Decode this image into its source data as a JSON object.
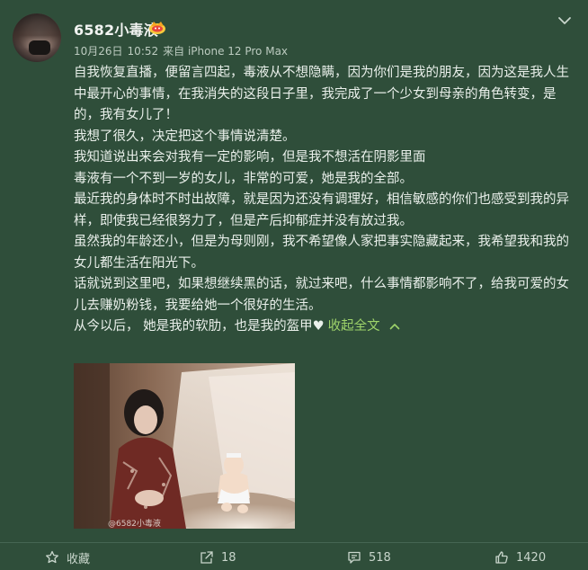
{
  "user": {
    "name": "6582小毒液",
    "vip_icon": "weibo-vip-badge-icon"
  },
  "meta": {
    "date": "10月26日",
    "time": "10:52",
    "source": "来自 iPhone 12 Pro Max"
  },
  "post": {
    "paragraphs": [
      "自我恢复直播，便留言四起，毒液从不想隐瞒，因为你们是我的朋友，因为这是我人生中最开心的事情，在我消失的这段日子里，我完成了一个少女到母亲的角色转变，是的，我有女儿了！",
      "我想了很久，决定把这个事情说清楚。",
      "我知道说出来会对我有一定的影响，但是我不想活在阴影里面",
      "毒液有一个不到一岁的女儿，非常的可爱，她是我的全部。",
      "最近我的身体时不时出故障，就是因为还没有调理好，相信敏感的你们也感受到我的异样，即使我已经很努力了，但是产后抑郁症并没有放过我。",
      "虽然我的年龄还小，但是为母则刚，我不希望像人家把事实隐藏起来，我希望我和我的女儿都生活在阳光下。",
      "话就说到这里吧，如果想继续黑的话，就过来吧，什么事情都影响不了，给我可爱的女儿去赚奶粉钱，我要给她一个很好的生活。"
    ],
    "last_line": "从今以后， 她是我的软肋，也是我的盔甲♥",
    "collapse_label": "收起全文"
  },
  "photo": {
    "watermark": "@6582小毒液"
  },
  "actions": {
    "favorite_label": "收藏",
    "share_count": "18",
    "comment_count": "518",
    "like_count": "1420"
  },
  "colors": {
    "background": "#2f4e3a",
    "link": "#9ed36a",
    "text": "#eaf0eb"
  }
}
